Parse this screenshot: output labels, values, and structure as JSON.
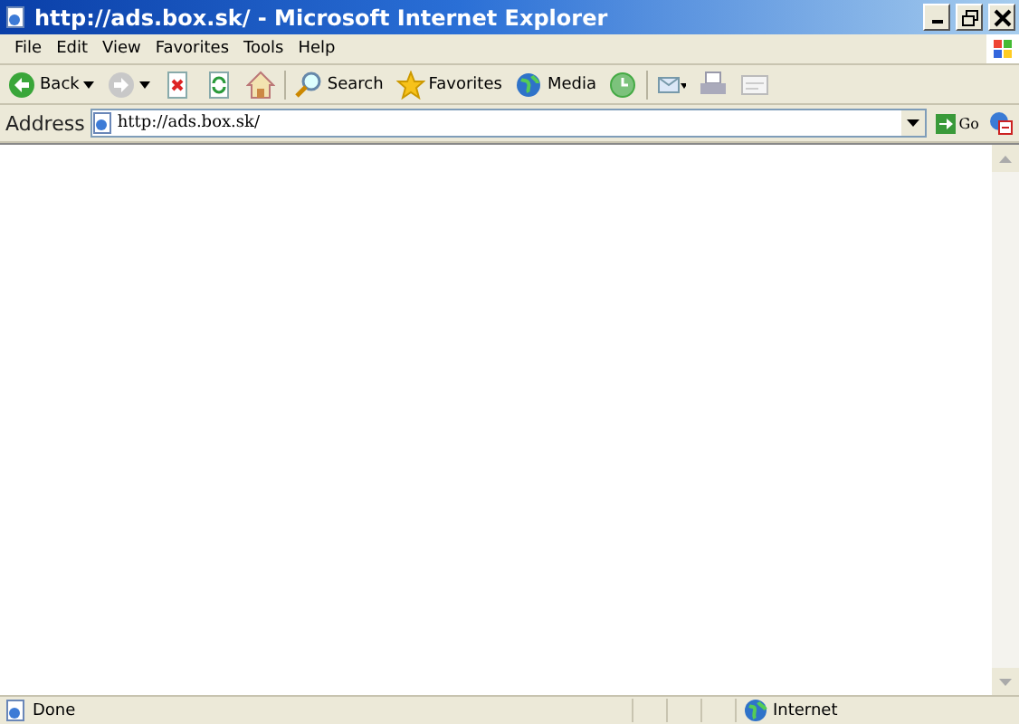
{
  "window": {
    "title": "http://ads.box.sk/ - Microsoft Internet Explorer"
  },
  "menu": [
    "File",
    "Edit",
    "View",
    "Favorites",
    "Tools",
    "Help"
  ],
  "toolbar": [
    {
      "kind": "back",
      "label": "Back",
      "disabled": false
    },
    {
      "kind": "forward",
      "disabled": true
    },
    {
      "kind": "stop",
      "disabled": false
    },
    {
      "kind": "refresh",
      "disabled": false
    },
    {
      "kind": "home",
      "disabled": false
    },
    {
      "kind": "search",
      "label": "Search",
      "disabled": false
    },
    {
      "kind": "favorites",
      "label": "Favorites",
      "disabled": false
    },
    {
      "kind": "media",
      "label": "Media",
      "disabled": false
    },
    {
      "kind": "history",
      "disabled": false
    },
    {
      "kind": "mail",
      "disabled": false
    },
    {
      "kind": "print",
      "disabled": false
    },
    {
      "kind": "edit",
      "disabled": true
    }
  ],
  "address": {
    "label": "Address",
    "value": "http://ads.box.sk/"
  },
  "go_button": "Go",
  "status_bar": {
    "text": "Done",
    "zone": "Internet"
  }
}
